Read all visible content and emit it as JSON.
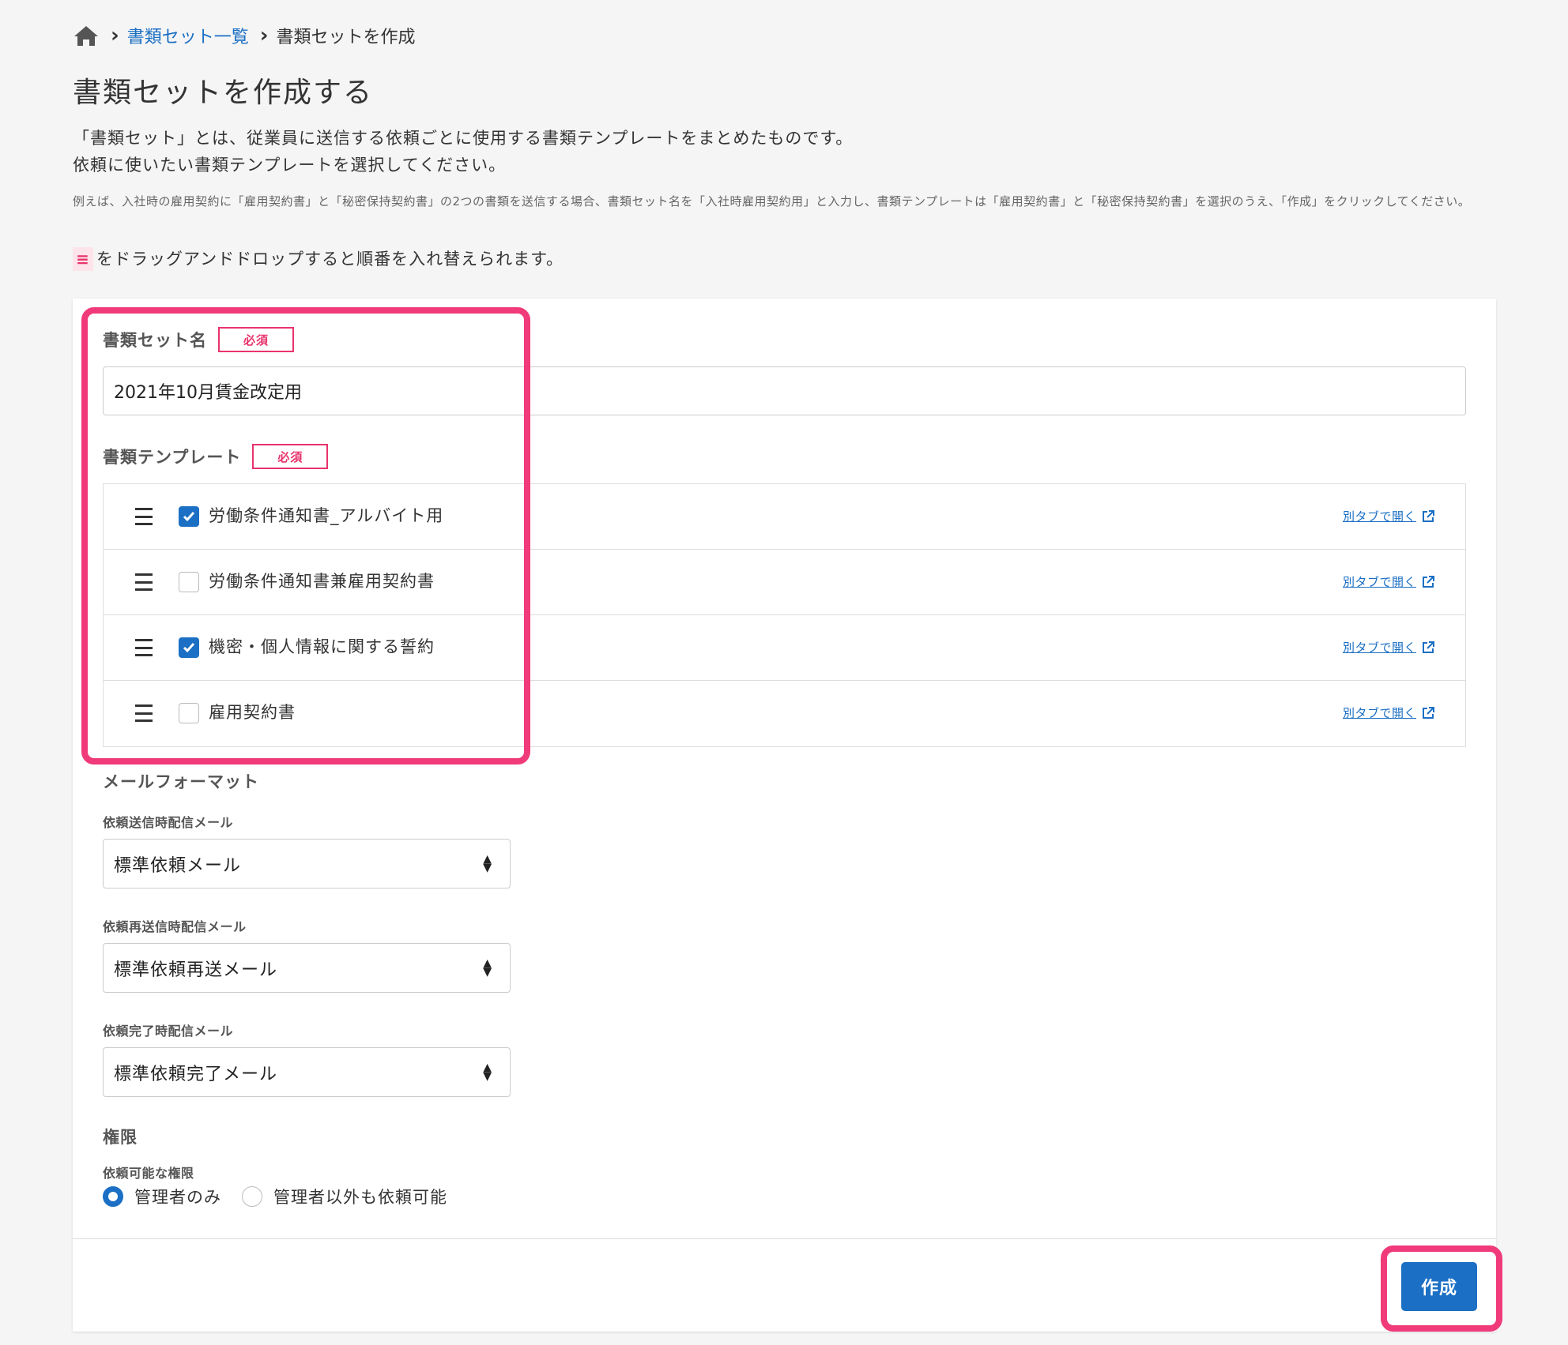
{
  "breadcrumb": {
    "home_icon": "home-icon",
    "list_link": "書類セット一覧",
    "current": "書類セットを作成"
  },
  "title": "書類セットを作成する",
  "intro": {
    "line1": "「書類セット」とは、従業員に送信する依頼ごとに使用する書類テンプレートをまとめたものです。",
    "line2": "依頼に使いたい書類テンプレートを選択してください。"
  },
  "example": "例えば、入社時の雇用契約に「雇用契約書」と「秘密保持契約書」の2つの書類を送信する場合、書類セット名を「入社時雇用契約用」と入力し、書類テンプレートは「雇用契約書」と「秘密保持契約書」を選択のうえ、「作成」をクリックしてください。",
  "dnd_hint": {
    "handle": "≡",
    "text": "をドラッグアンドドロップすると順番を入れ替えられます。"
  },
  "form": {
    "set_name_label": "書類セット名",
    "required_badge": "必須",
    "set_name_value": "2021年10月賃金改定用",
    "templates_label": "書類テンプレート",
    "open_link_label": "別タブで開く",
    "templates": [
      {
        "name": "労働条件通知書_アルバイト用",
        "checked": true
      },
      {
        "name": "労働条件通知書兼雇用契約書",
        "checked": false
      },
      {
        "name": "機密・個人情報に関する誓約",
        "checked": true
      },
      {
        "name": "雇用契約書",
        "checked": false
      }
    ],
    "mail_format_label": "メールフォーマット",
    "mail_send_label": "依頼送信時配信メール",
    "mail_send_value": "標準依頼メール",
    "mail_resend_label": "依頼再送信時配信メール",
    "mail_resend_value": "標準依頼再送メール",
    "mail_complete_label": "依頼完了時配信メール",
    "mail_complete_value": "標準依頼完了メール",
    "permission_label": "権限",
    "permission_sub_label": "依頼可能な権限",
    "permission_options": [
      {
        "label": "管理者のみ",
        "selected": true
      },
      {
        "label": "管理者以外も依頼可能",
        "selected": false
      }
    ],
    "submit_label": "作成"
  },
  "colors": {
    "accent": "#1b6fc4",
    "required": "#e8336c",
    "highlight": "#f03a7a"
  }
}
